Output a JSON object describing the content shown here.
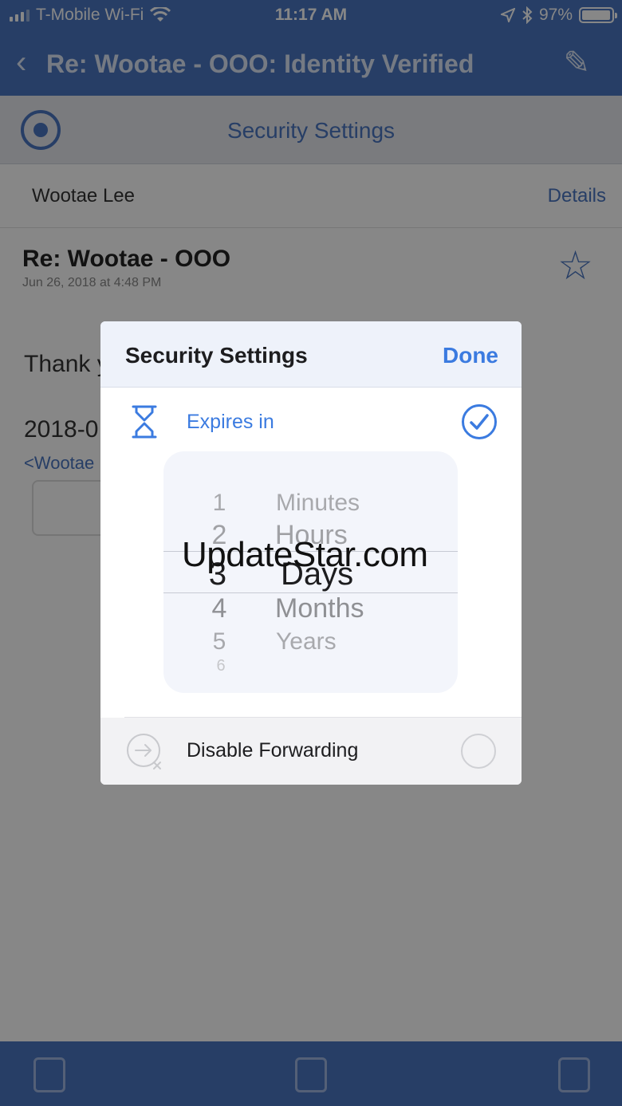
{
  "status_bar": {
    "carrier": "T-Mobile Wi-Fi",
    "time": "11:17 AM",
    "battery": "97%",
    "battery_level": 0.97
  },
  "background": {
    "nav_title": "Re: Wootae - OOO: Identity Verified",
    "security_bar_label": "Security Settings",
    "sender": "Wootae Lee",
    "details_link": "Details",
    "subject": "Re: Wootae - OOO",
    "date": "Jun 26, 2018 at 4:48 PM",
    "body_line1": "Thank y",
    "body_line2": "2018-0",
    "body_line3": "<Wootae"
  },
  "modal": {
    "title": "Security Settings",
    "done_label": "Done",
    "expires_label": "Expires in",
    "picker": {
      "numbers": [
        "1",
        "2",
        "3",
        "4",
        "5",
        "6"
      ],
      "units": [
        "Minutes",
        "Hours",
        "Days",
        "Months",
        "Years"
      ],
      "selected_number": "3",
      "selected_unit": "Days"
    },
    "forward_label": "Disable Forwarding"
  },
  "watermark": "UpdateStar.com",
  "colors": {
    "accent": "#3b7be0",
    "app_blue": "#4a76c0"
  },
  "icons": {
    "expires": "hourglass-icon",
    "checked": "check-circle-icon",
    "forward": "forward-disabled-icon"
  }
}
